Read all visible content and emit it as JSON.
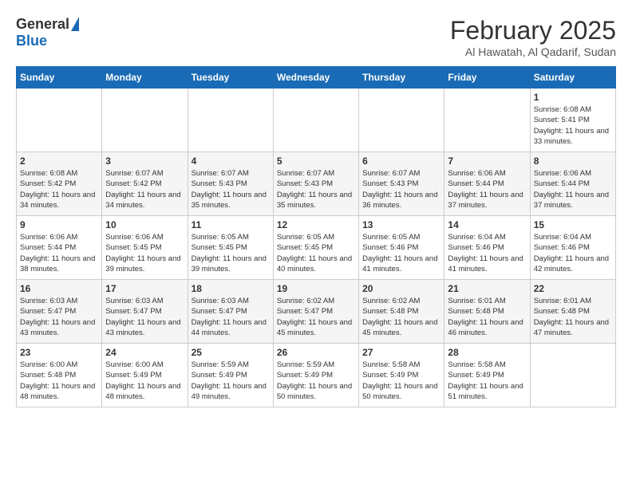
{
  "header": {
    "logo_general": "General",
    "logo_blue": "Blue",
    "month_year": "February 2025",
    "location": "Al Hawatah, Al Qadarif, Sudan"
  },
  "calendar": {
    "days_of_week": [
      "Sunday",
      "Monday",
      "Tuesday",
      "Wednesday",
      "Thursday",
      "Friday",
      "Saturday"
    ],
    "weeks": [
      [
        {
          "day": "",
          "info": ""
        },
        {
          "day": "",
          "info": ""
        },
        {
          "day": "",
          "info": ""
        },
        {
          "day": "",
          "info": ""
        },
        {
          "day": "",
          "info": ""
        },
        {
          "day": "",
          "info": ""
        },
        {
          "day": "1",
          "info": "Sunrise: 6:08 AM\nSunset: 5:41 PM\nDaylight: 11 hours and 33 minutes."
        }
      ],
      [
        {
          "day": "2",
          "info": "Sunrise: 6:08 AM\nSunset: 5:42 PM\nDaylight: 11 hours and 34 minutes."
        },
        {
          "day": "3",
          "info": "Sunrise: 6:07 AM\nSunset: 5:42 PM\nDaylight: 11 hours and 34 minutes."
        },
        {
          "day": "4",
          "info": "Sunrise: 6:07 AM\nSunset: 5:43 PM\nDaylight: 11 hours and 35 minutes."
        },
        {
          "day": "5",
          "info": "Sunrise: 6:07 AM\nSunset: 5:43 PM\nDaylight: 11 hours and 35 minutes."
        },
        {
          "day": "6",
          "info": "Sunrise: 6:07 AM\nSunset: 5:43 PM\nDaylight: 11 hours and 36 minutes."
        },
        {
          "day": "7",
          "info": "Sunrise: 6:06 AM\nSunset: 5:44 PM\nDaylight: 11 hours and 37 minutes."
        },
        {
          "day": "8",
          "info": "Sunrise: 6:06 AM\nSunset: 5:44 PM\nDaylight: 11 hours and 37 minutes."
        }
      ],
      [
        {
          "day": "9",
          "info": "Sunrise: 6:06 AM\nSunset: 5:44 PM\nDaylight: 11 hours and 38 minutes."
        },
        {
          "day": "10",
          "info": "Sunrise: 6:06 AM\nSunset: 5:45 PM\nDaylight: 11 hours and 39 minutes."
        },
        {
          "day": "11",
          "info": "Sunrise: 6:05 AM\nSunset: 5:45 PM\nDaylight: 11 hours and 39 minutes."
        },
        {
          "day": "12",
          "info": "Sunrise: 6:05 AM\nSunset: 5:45 PM\nDaylight: 11 hours and 40 minutes."
        },
        {
          "day": "13",
          "info": "Sunrise: 6:05 AM\nSunset: 5:46 PM\nDaylight: 11 hours and 41 minutes."
        },
        {
          "day": "14",
          "info": "Sunrise: 6:04 AM\nSunset: 5:46 PM\nDaylight: 11 hours and 41 minutes."
        },
        {
          "day": "15",
          "info": "Sunrise: 6:04 AM\nSunset: 5:46 PM\nDaylight: 11 hours and 42 minutes."
        }
      ],
      [
        {
          "day": "16",
          "info": "Sunrise: 6:03 AM\nSunset: 5:47 PM\nDaylight: 11 hours and 43 minutes."
        },
        {
          "day": "17",
          "info": "Sunrise: 6:03 AM\nSunset: 5:47 PM\nDaylight: 11 hours and 43 minutes."
        },
        {
          "day": "18",
          "info": "Sunrise: 6:03 AM\nSunset: 5:47 PM\nDaylight: 11 hours and 44 minutes."
        },
        {
          "day": "19",
          "info": "Sunrise: 6:02 AM\nSunset: 5:47 PM\nDaylight: 11 hours and 45 minutes."
        },
        {
          "day": "20",
          "info": "Sunrise: 6:02 AM\nSunset: 5:48 PM\nDaylight: 11 hours and 45 minutes."
        },
        {
          "day": "21",
          "info": "Sunrise: 6:01 AM\nSunset: 5:48 PM\nDaylight: 11 hours and 46 minutes."
        },
        {
          "day": "22",
          "info": "Sunrise: 6:01 AM\nSunset: 5:48 PM\nDaylight: 11 hours and 47 minutes."
        }
      ],
      [
        {
          "day": "23",
          "info": "Sunrise: 6:00 AM\nSunset: 5:48 PM\nDaylight: 11 hours and 48 minutes."
        },
        {
          "day": "24",
          "info": "Sunrise: 6:00 AM\nSunset: 5:49 PM\nDaylight: 11 hours and 48 minutes."
        },
        {
          "day": "25",
          "info": "Sunrise: 5:59 AM\nSunset: 5:49 PM\nDaylight: 11 hours and 49 minutes."
        },
        {
          "day": "26",
          "info": "Sunrise: 5:59 AM\nSunset: 5:49 PM\nDaylight: 11 hours and 50 minutes."
        },
        {
          "day": "27",
          "info": "Sunrise: 5:58 AM\nSunset: 5:49 PM\nDaylight: 11 hours and 50 minutes."
        },
        {
          "day": "28",
          "info": "Sunrise: 5:58 AM\nSunset: 5:49 PM\nDaylight: 11 hours and 51 minutes."
        },
        {
          "day": "",
          "info": ""
        }
      ]
    ]
  }
}
